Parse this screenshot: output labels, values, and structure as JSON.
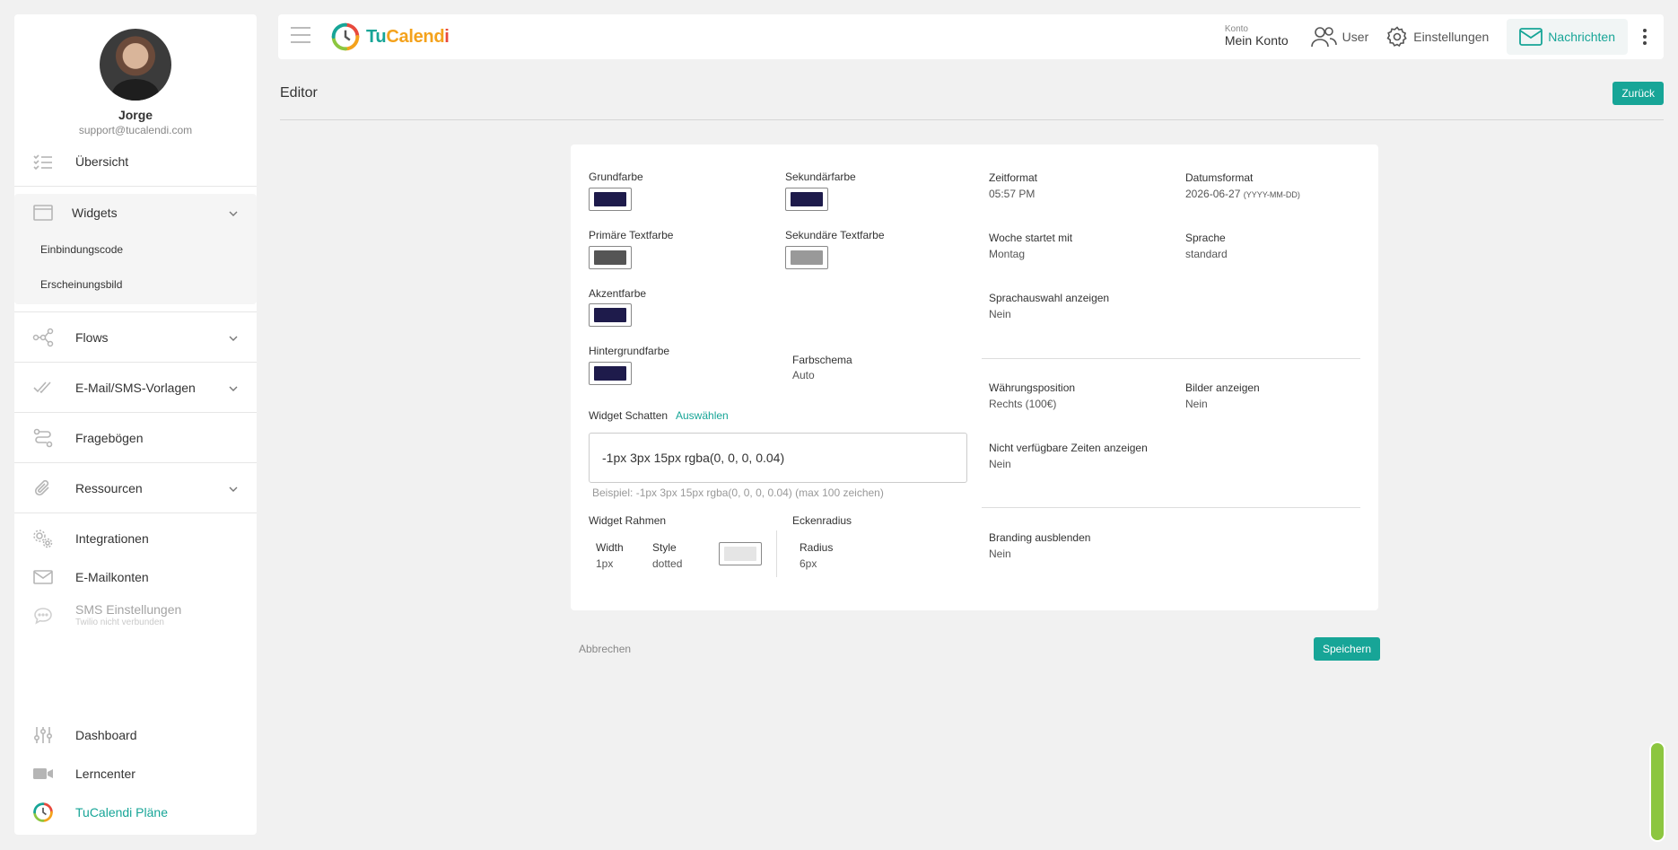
{
  "profile": {
    "name": "Jorge",
    "email": "support@tucalendi.com"
  },
  "sidebar": {
    "overview": "Übersicht",
    "widgets": "Widgets",
    "widget_sub": [
      "Einbindungscode",
      "Erscheinungsbild"
    ],
    "flows": "Flows",
    "templates": "E-Mail/SMS-Vorlagen",
    "questionnaires": "Fragebögen",
    "resources": "Ressourcen",
    "integrations": "Integrationen",
    "mail_accounts": "E-Mailkonten",
    "sms_settings": "SMS Einstellungen",
    "sms_status": "Twilio nicht verbunden",
    "dashboard": "Dashboard",
    "learning": "Lerncenter",
    "plans": "TuCalendi Pläne"
  },
  "topbar": {
    "logo_a": "Tu",
    "logo_b": "Calend",
    "logo_c": "i",
    "account_caption": "Konto",
    "account_label": "Mein Konto",
    "user": "User",
    "settings": "Einstellungen",
    "messages": "Nachrichten"
  },
  "page": {
    "title": "Editor",
    "back": "Zurück",
    "cancel": "Abbrechen",
    "save": "Speichern"
  },
  "editor": {
    "primary_color_label": "Grundfarbe",
    "secondary_color_label": "Sekundärfarbe",
    "primary_text_label": "Primäre Textfarbe",
    "secondary_text_label": "Sekundäre Textfarbe",
    "accent_label": "Akzentfarbe",
    "background_label": "Hintergrundfarbe",
    "scheme_label": "Farbschema",
    "scheme_value": "Auto",
    "shadow_label": "Widget Schatten",
    "shadow_select": "Auswählen",
    "shadow_value": "-1px 3px 15px rgba(0, 0, 0, 0.04)",
    "shadow_hint": "Beispiel: -1px 3px 15px rgba(0, 0, 0, 0.04) (max 100 zeichen)",
    "border_label": "Widget Rahmen",
    "border_width_label": "Width",
    "border_width_value": "1px",
    "border_style_label": "Style",
    "border_style_value": "dotted",
    "radius_label": "Eckenradius",
    "radius_sub_label": "Radius",
    "radius_value": "6px",
    "time_format_label": "Zeitformat",
    "time_format_value": "05:57 PM",
    "date_format_label": "Datumsformat",
    "date_format_value": "2026-06-27",
    "date_format_hint": "(YYYY-MM-DD)",
    "week_start_label": "Woche startet mit",
    "week_start_value": "Montag",
    "language_label": "Sprache",
    "language_value": "standard",
    "lang_select_label": "Sprachauswahl anzeigen",
    "lang_select_value": "Nein",
    "currency_pos_label": "Währungsposition",
    "currency_pos_value": "Rechts (100€)",
    "images_label": "Bilder anzeigen",
    "images_value": "Nein",
    "unavailable_label": "Nicht verfügbare Zeiten anzeigen",
    "unavailable_value": "Nein",
    "branding_label": "Branding ausblenden",
    "branding_value": "Nein"
  },
  "colors": {
    "brand": "#17a597",
    "primary": "#1e1b4b",
    "secondary": "#1e1b4b",
    "primary_text": "#555555",
    "secondary_text": "#999999",
    "accent": "#1e1b4b",
    "background": "#1e1b4b",
    "border": "#e5e5e5"
  }
}
